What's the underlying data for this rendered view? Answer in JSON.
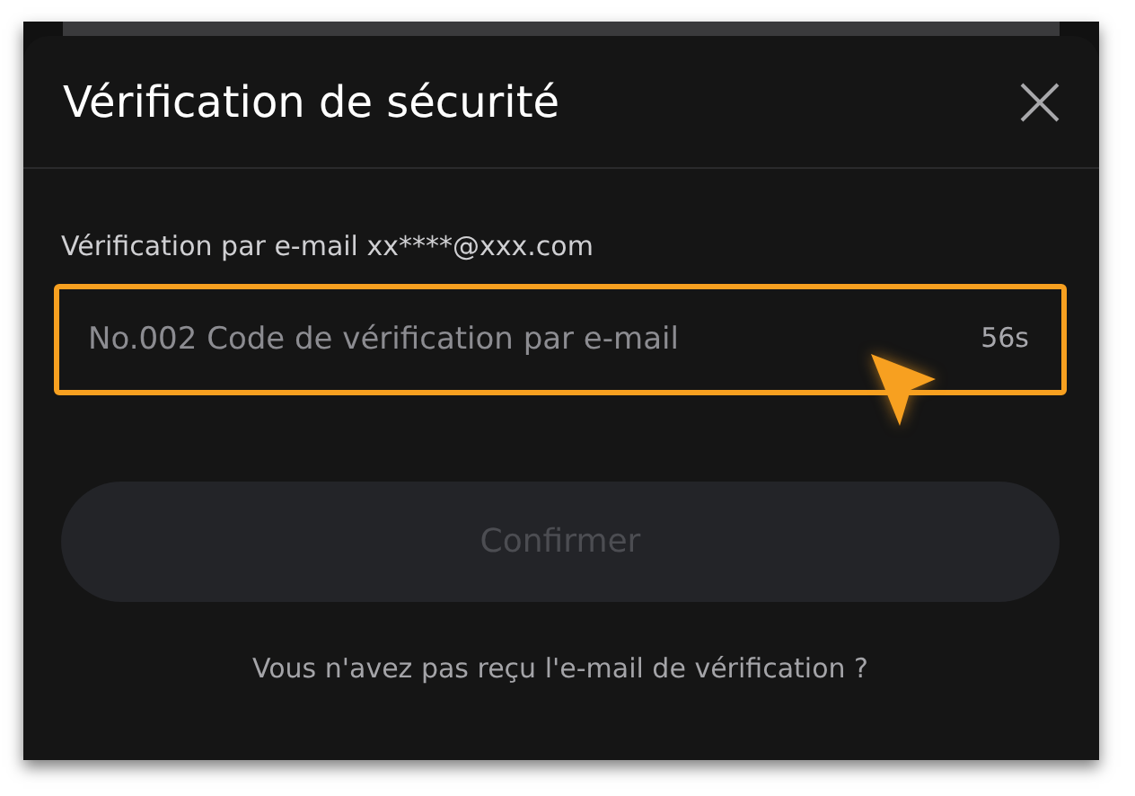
{
  "dialog": {
    "title": "Vérification de sécurité"
  },
  "email_label": "Vérification par e-mail xx****@xxx.com",
  "code_field": {
    "placeholder": "No.002 Code de vérification par e-mail",
    "countdown": "56s",
    "highlighted": true
  },
  "confirm_button": {
    "label": "Confirmer",
    "disabled": true
  },
  "resend_link": "Vous n'avez pas reçu l'e-mail de vérification ?"
}
